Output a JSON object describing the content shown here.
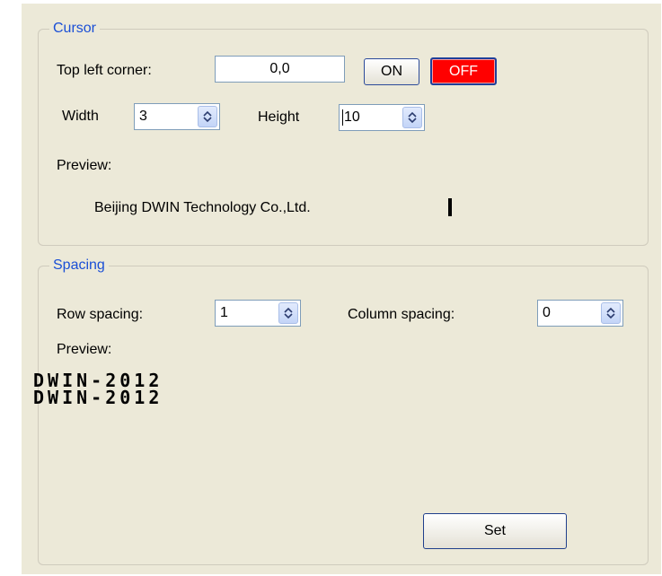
{
  "cursor": {
    "title": "Cursor",
    "top_left_label": "Top left corner:",
    "top_left_value": "0,0",
    "on_label": "ON",
    "off_label": "OFF",
    "width_label": "Width",
    "width_value": "3",
    "height_label": "Height",
    "height_value": "10",
    "preview_label": "Preview:",
    "preview_text": "Beijing DWIN Technology Co.,Ltd."
  },
  "spacing": {
    "title": "Spacing",
    "row_label": "Row spacing:",
    "row_value": "1",
    "column_label": "Column spacing:",
    "column_value": "0",
    "preview_label": "Preview:",
    "preview_lines": [
      "DWIN-2012",
      "DWIN-2012"
    ]
  },
  "set_label": "Set",
  "icons": {
    "spinner": "up-down-arrows-icon"
  },
  "colors": {
    "off_button": "#ff0000",
    "group_title": "#1a4fd6",
    "panel_bg": "#ece9d8"
  }
}
